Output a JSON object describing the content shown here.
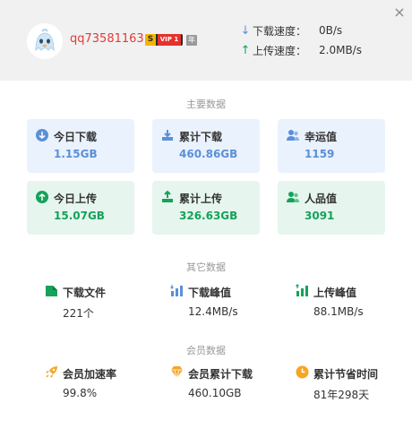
{
  "header": {
    "username": "qq73581163",
    "vip_label": "VIP 1",
    "year_badge": "年",
    "download_speed_label": "下载速度：",
    "download_speed_value": "0B/s",
    "upload_speed_label": "上传速度：",
    "upload_speed_value": "2.0MB/s",
    "close": "×"
  },
  "main_section": {
    "title": "主要数据",
    "cards": [
      {
        "label": "今日下载",
        "value": "1.15GB",
        "icon": "download-circle-icon"
      },
      {
        "label": "累计下载",
        "value": "460.86GB",
        "icon": "download-tray-icon"
      },
      {
        "label": "幸运值",
        "value": "1159",
        "icon": "users-icon"
      },
      {
        "label": "今日上传",
        "value": "15.07GB",
        "icon": "upload-circle-icon"
      },
      {
        "label": "累计上传",
        "value": "326.63GB",
        "icon": "upload-tray-icon"
      },
      {
        "label": "人品值",
        "value": "3091",
        "icon": "user-group-icon"
      }
    ]
  },
  "other_section": {
    "title": "其它数据",
    "stats": [
      {
        "label": "下载文件",
        "value": "221个",
        "icon": "file-icon"
      },
      {
        "label": "下载峰值",
        "value": "12.4MB/s",
        "icon": "bar-chart-down-icon"
      },
      {
        "label": "上传峰值",
        "value": "88.1MB/s",
        "icon": "bar-chart-up-icon"
      }
    ]
  },
  "member_section": {
    "title": "会员数据",
    "stats": [
      {
        "label": "会员加速率",
        "value": "99.8%",
        "icon": "rocket-icon"
      },
      {
        "label": "会员累计下载",
        "value": "460.10GB",
        "icon": "diamond-icon"
      },
      {
        "label": "累计节省时间",
        "value": "81年298天",
        "icon": "clock-icon"
      }
    ]
  },
  "colors": {
    "blue_accent": "#5b8fd9",
    "green_accent": "#16a25a",
    "orange_accent": "#f5a623",
    "username_red": "#e43a3a"
  }
}
